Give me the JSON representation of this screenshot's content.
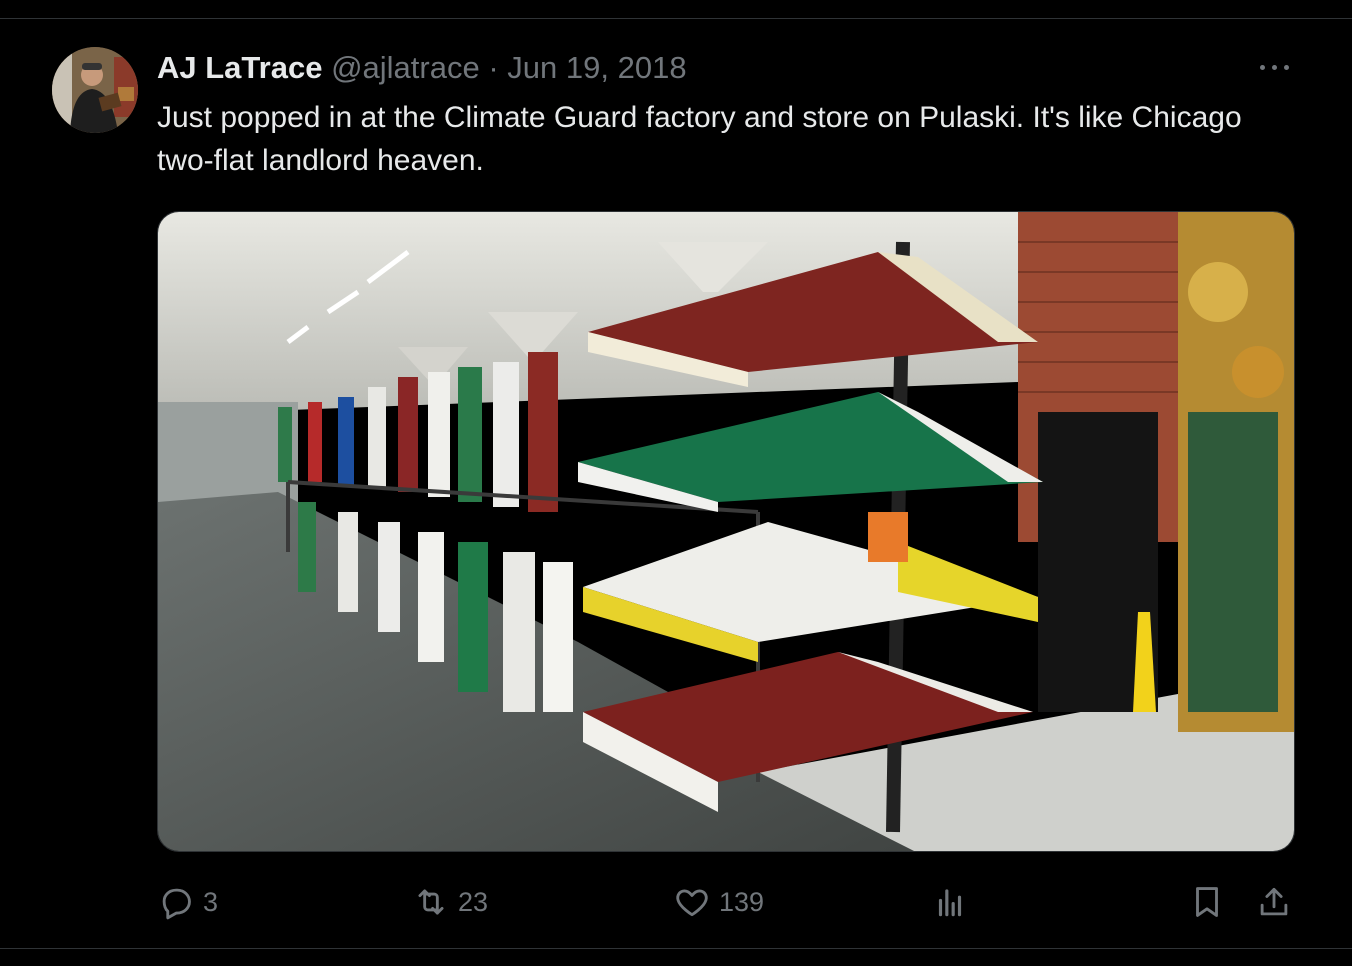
{
  "tweet": {
    "author_name": "AJ LaTrace",
    "handle": "@ajlatrace",
    "separator": "·",
    "date": "Jun 19, 2018",
    "text": "Just popped in at the Climate Guard factory and store on Pulaski. It's like Chicago two-flat landlord heaven.",
    "media_icon": "photo-of-awning-store"
  },
  "actions": {
    "replies": "3",
    "reposts": "23",
    "likes": "139",
    "icons": [
      "reply-icon",
      "repost-icon",
      "like-icon",
      "views-icon",
      "bookmark-icon",
      "share-icon"
    ]
  },
  "colors": {
    "background": "#000000",
    "text": "#e7e9ea",
    "muted": "#71767b",
    "border": "#2f3336"
  }
}
